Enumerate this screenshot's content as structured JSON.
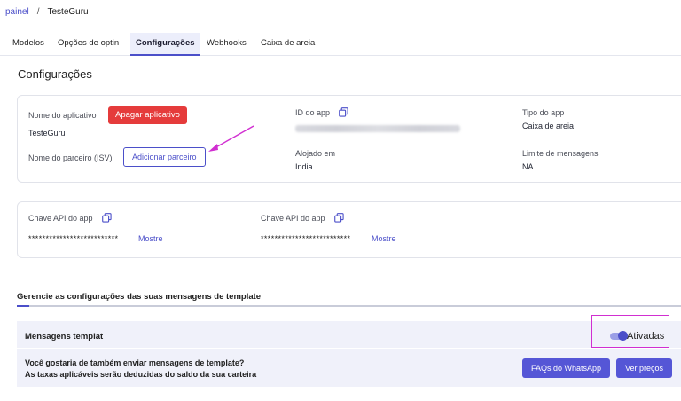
{
  "breadcrumb": {
    "parent": "painel",
    "separator": "/",
    "current": "TesteGuru"
  },
  "tabs": [
    {
      "label": "Modelos"
    },
    {
      "label": "Opções de optin"
    },
    {
      "label": "Configurações"
    },
    {
      "label": "Webhooks"
    },
    {
      "label": "Caixa de areia"
    }
  ],
  "active_tab": "Configurações",
  "page_title": "Configurações",
  "app_info": {
    "app_name_label": "Nome do aplicativo",
    "delete_button": "Apagar aplicativo",
    "app_name_value": "TesteGuru",
    "partner_label": "Nome do parceiro (ISV)",
    "add_partner_button": "Adicionar parceiro",
    "app_id_label": "ID do app",
    "hosted_label": "Alojado em",
    "hosted_value": "India",
    "app_type_label": "Tipo do app",
    "app_type_value": "Caixa de areia",
    "message_limit_label": "Limite de mensagens",
    "message_limit_value": "NA"
  },
  "api_keys": [
    {
      "label": "Chave API do app",
      "masked": "**************************",
      "show_link": "Mostre"
    },
    {
      "label": "Chave API do app",
      "masked": "**************************",
      "show_link": "Mostre"
    }
  ],
  "template_section": {
    "title": "Gerencie as configurações das suas mensagens de template",
    "row_label": "Mensagens templat",
    "toggle_label": "Ativadas",
    "toggle_on": true,
    "question": "Você gostaria de também enviar mensagens de template?",
    "note": "As taxas aplicáveis serão deduzidas do saldo da sua carteira",
    "faq_button": "FAQs do WhatsApp",
    "prices_button": "Ver preços"
  },
  "colors": {
    "accent": "#4b4fc9",
    "danger": "#e53b3b",
    "highlight": "#d12fd1"
  }
}
